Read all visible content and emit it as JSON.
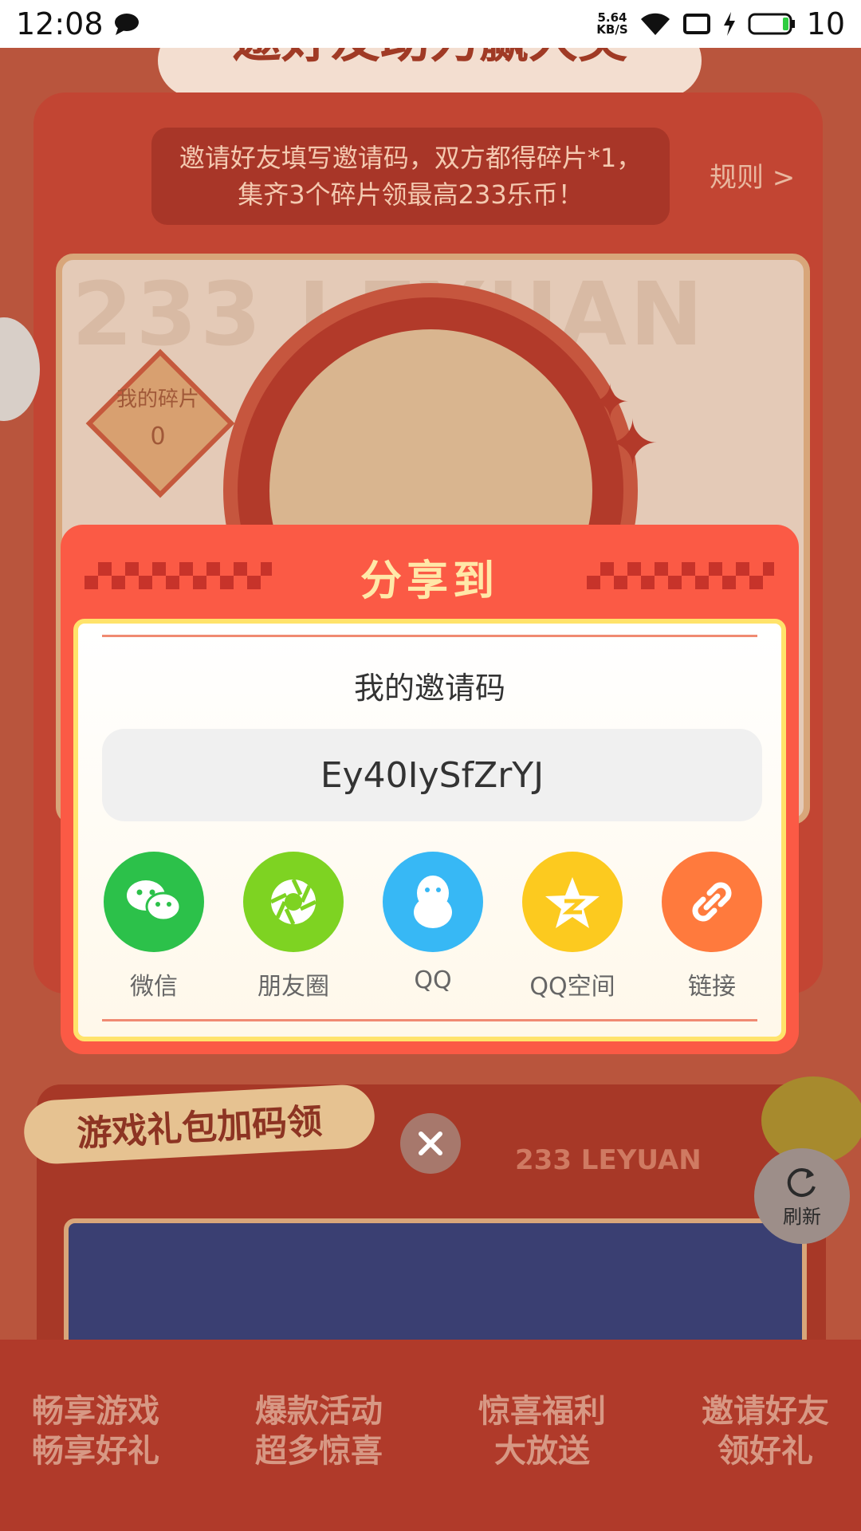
{
  "status_bar": {
    "time": "12:08",
    "net_speed_value": "5.64",
    "net_speed_unit": "KB/S",
    "battery": "10"
  },
  "background": {
    "banner_title": "邀好友助力赢大奖",
    "rules_text": "邀请好友填写邀请码，双方都得碎片*1，集齐3个碎片领最高233乐币！",
    "rules_link": "规则 >",
    "watermark": "233 LEYUAN",
    "my_pieces_label": "我的碎片",
    "my_pieces_count": "0",
    "section2_title": "游戏礼包加码领",
    "leyuan_label": "233 LEYUAN",
    "refresh_label": "刷新",
    "bottom_labels": [
      "畅享游戏\n畅享好礼",
      "爆款活动\n超多惊喜",
      "惊喜福利\n大放送",
      "邀请好友\n领好礼"
    ]
  },
  "modal": {
    "title": "分享到",
    "code_label": "我的邀请码",
    "invite_code": "Ey40IySfZrYJ",
    "share_targets": [
      {
        "label": "微信",
        "icon": "wechat-icon",
        "color": "#2cc14a"
      },
      {
        "label": "朋友圈",
        "icon": "moments-icon",
        "color": "#7ed322"
      },
      {
        "label": "QQ",
        "icon": "qq-icon",
        "color": "#37b8f5"
      },
      {
        "label": "QQ空间",
        "icon": "qzone-icon",
        "color": "#fcca1f"
      },
      {
        "label": "链接",
        "icon": "link-icon",
        "color": "#ff7a3d"
      }
    ]
  },
  "colors": {
    "modal_bg": "#fb5a45",
    "modal_title": "#ffe8a8",
    "dim_background": "#b9553d"
  }
}
